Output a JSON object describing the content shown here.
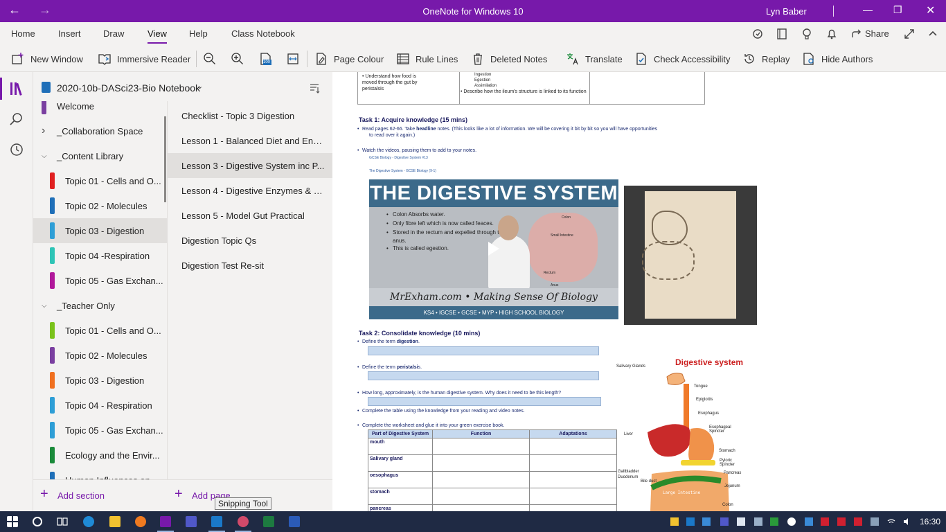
{
  "app": {
    "title": "OneNote for Windows 10",
    "user": "Lyn Baber",
    "accent": "#7719aa"
  },
  "ribbon": {
    "tabs": [
      "Home",
      "Insert",
      "Draw",
      "View",
      "Help",
      "Class Notebook"
    ],
    "active_tab": "View",
    "share_label": "Share",
    "right_icons": [
      "sync-status-icon",
      "notebook-icon",
      "lightbulb-icon",
      "bell-icon",
      "share-icon",
      "expand-icon",
      "collapse-icon"
    ]
  },
  "toolbar": {
    "new_window": "New Window",
    "immersive_reader": "Immersive Reader",
    "page_colour": "Page Colour",
    "rule_lines": "Rule Lines",
    "deleted_notes": "Deleted Notes",
    "translate": "Translate",
    "check_accessibility": "Check Accessibility",
    "replay": "Replay",
    "hide_authors": "Hide Authors",
    "zoom_page_width_label": "100"
  },
  "notebook": {
    "name": "2020-10b-DASci23-Bio Notebook",
    "sections": [
      {
        "label": "Welcome",
        "color": "#7a3fa0"
      },
      {
        "label": "_Collaboration Space",
        "group": true,
        "expanded": false
      },
      {
        "label": "_Content Library",
        "group": true,
        "expanded": true
      },
      {
        "label": "Topic 01 - Cells and O...",
        "color": "#e02020"
      },
      {
        "label": "Topic 02 - Molecules",
        "color": "#1f6fb8"
      },
      {
        "label": "Topic 03 - Digestion",
        "color": "#2e9ed6",
        "selected": true
      },
      {
        "label": "Topic 04 -Respiration",
        "color": "#2ec4b6"
      },
      {
        "label": "Topic 05 - Gas Exchan...",
        "color": "#b0189a"
      },
      {
        "label": "_Teacher Only",
        "group": true,
        "expanded": true
      },
      {
        "label": "Topic 01 - Cells and O...",
        "color": "#7ac21b"
      },
      {
        "label": "Topic 02 - Molecules",
        "color": "#7a3fa0"
      },
      {
        "label": "Topic 03 - Digestion",
        "color": "#f07020"
      },
      {
        "label": "Topic 04 - Respiration",
        "color": "#2e9ed6"
      },
      {
        "label": "Topic 05 - Gas Exchan...",
        "color": "#2e9ed6"
      },
      {
        "label": "Ecology and the Envir...",
        "color": "#1a8a3a"
      },
      {
        "label": "Human Influences on...",
        "color": "#1f6fb8"
      }
    ],
    "pages": [
      {
        "label": "Checklist - Topic 3 Digestion"
      },
      {
        "label": "Lesson 1 - Balanced Diet and Ener..."
      },
      {
        "label": "Lesson 3 - Digestive System inc P...",
        "selected": true
      },
      {
        "label": "Lesson 4 - Digestive Enzymes & B..."
      },
      {
        "label": "Lesson 5 - Model Gut Practical"
      },
      {
        "label": "Digestion Topic Qs"
      },
      {
        "label": "Digestion Test Re-sit"
      }
    ],
    "add_section": "Add section",
    "add_page": "Add page",
    "tooltip": "Snipping Tool"
  },
  "canvas": {
    "top_table": {
      "col1": "• Understand how food is moved through the gut by peristalsis",
      "col2_items": [
        "Ingestion",
        "Egestion",
        "Assimilation"
      ],
      "col2_bullet": "Describe how the ileum's structure is linked to its function"
    },
    "task1": {
      "heading": "Task 1:  Acquire knowledge (15 mins)",
      "read_pre": "Read pages 62-66. Take ",
      "read_bold": "headline",
      "read_post": " notes. (This looks like a lot of information.  We will be covering it bit by bit so you will have opportunities",
      "read_cont": "to read over it again.)",
      "watch": "Watch the videos, pausing them to add to your notes.",
      "link1": "GCSE Biology - Digestive System  #13",
      "link2": "The Digestive System - GCSE Biology (9-1)"
    },
    "video": {
      "title": "THE DIGESTIVE SYSTEM",
      "bullets": [
        "Colon Absorbs water.",
        "Only fibre left which is now called feaces.",
        "Stored in the rectum and expelled through the",
        "anus.",
        "This is called egestion."
      ],
      "labels": [
        "Colon",
        "Small Intestine",
        "Rectum",
        "Anus"
      ],
      "brand": "MrExham.com • Making Sense Of Biology",
      "footer": "KS4 • IGCSE • GCSE • MYP • HIGH SCHOOL BIOLOGY"
    },
    "task2": {
      "heading": "Task 2:  Consolidate knowledge (10 mins)",
      "q1_pre": "Define the term ",
      "q1_bold": "digestion",
      "q1_post": ".",
      "q2_pre": "Define the term ",
      "q2_bold": "peristalsi",
      "q2_post": "s.",
      "q3": "How long, approximately, is the human digestive system.  Why does it need to be this length?",
      "q4": "Complete the table using the knowledge from your reading and video notes.",
      "q5": "Complete the worksheet and glue it into your green exercise book."
    },
    "table": {
      "headers": [
        "Part of Digestive System",
        "Function",
        "Adaptations"
      ],
      "rows": [
        "mouth",
        "Salivary gland",
        "oesophagus",
        "stomach",
        "pancreas"
      ]
    },
    "diagram": {
      "title": "Digestive system",
      "labels": [
        "Salivary Glands",
        "Tongue",
        "Epiglottis",
        "Esophagus",
        "Esophageal Spincter",
        "Liver",
        "Stomach",
        "Pyloric Spincter",
        "Gallbladder",
        "Duodenum",
        "Pancreas",
        "Bile duct",
        "Jejunum",
        "Large Intestine",
        "Colon"
      ]
    }
  },
  "taskbar": {
    "clock": "16:30",
    "apps": [
      "start",
      "cortana",
      "task-view",
      "edge",
      "file-explorer",
      "firefox",
      "onenote",
      "teams",
      "outlook",
      "snipping-tool",
      "excel",
      "word"
    ]
  }
}
